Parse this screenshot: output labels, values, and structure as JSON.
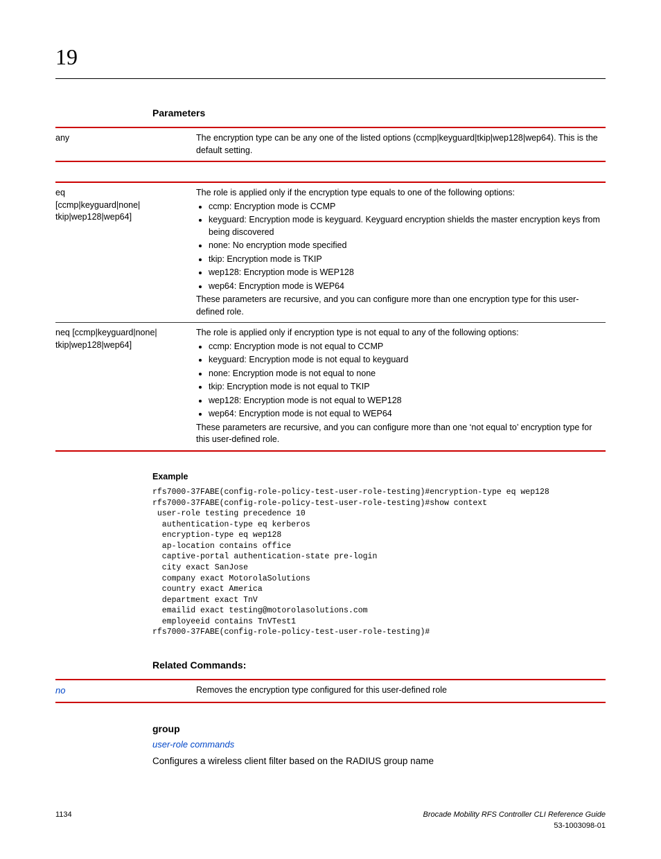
{
  "chapter": "19",
  "headings": {
    "parameters": "Parameters",
    "example": "Example",
    "related": "Related Commands:",
    "group": "group"
  },
  "table1": {
    "rows": [
      {
        "left": "any",
        "rightText": "The encryption type can be any one of the listed options (ccmp|keyguard|tkip|wep128|wep64). This is the default setting."
      }
    ]
  },
  "table2": {
    "rows": [
      {
        "leftLines": [
          "eq",
          "[ccmp|keyguard|none|",
          "tkip|wep128|wep64]"
        ],
        "intro": "The role is applied only if the encryption type equals to one of the following options:",
        "bullets": [
          "ccmp: Encryption mode is CCMP",
          "keyguard: Encryption mode is keyguard. Keyguard encryption shields the master encryption keys from being discovered",
          "none: No encryption mode specified",
          "tkip: Encryption mode is TKIP",
          "wep128: Encryption mode is WEP128",
          "wep64: Encryption mode is WEP64"
        ],
        "outro": "These parameters are recursive, and you can configure more than one encryption type for this user-defined role."
      },
      {
        "leftLines": [
          "neq [ccmp|keyguard|none|",
          "tkip|wep128|wep64]"
        ],
        "intro": "The role is applied only if encryption type is not equal to any of the following options:",
        "bullets": [
          "ccmp: Encryption mode is not equal to CCMP",
          "keyguard: Encryption mode is not equal to keyguard",
          "none: Encryption mode is not equal to none",
          "tkip: Encryption mode is not equal to TKIP",
          "wep128: Encryption mode is not equal to WEP128",
          "wep64: Encryption mode is not equal to WEP64"
        ],
        "outro": "These parameters are recursive, and you can configure more than one ‘not equal to’ encryption type for this user-defined role."
      }
    ]
  },
  "exampleCode": "rfs7000-37FABE(config-role-policy-test-user-role-testing)#encryption-type eq wep128\nrfs7000-37FABE(config-role-policy-test-user-role-testing)#show context\n user-role testing precedence 10\n  authentication-type eq kerberos\n  encryption-type eq wep128\n  ap-location contains office\n  captive-portal authentication-state pre-login\n  city exact SanJose\n  company exact MotorolaSolutions\n  country exact America\n  department exact TnV\n  emailid exact testing@motorolasolutions.com\n  employeeid contains TnVTest1\nrfs7000-37FABE(config-role-policy-test-user-role-testing)#",
  "related": {
    "rows": [
      {
        "left": "no",
        "right": "Removes the encryption type configured for this user-defined role"
      }
    ]
  },
  "group": {
    "link": "user-role commands",
    "desc": "Configures a wireless client filter based on the RADIUS group name"
  },
  "footer": {
    "page": "1134",
    "title": "Brocade Mobility RFS Controller CLI Reference Guide",
    "docnum": "53-1003098-01"
  }
}
